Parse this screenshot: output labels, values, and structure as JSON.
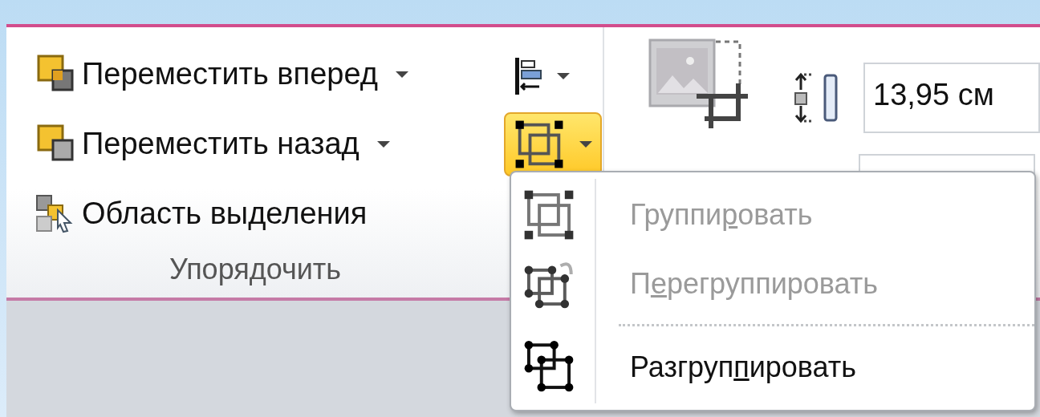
{
  "arrange_group": {
    "title": "Упорядочить",
    "commands": [
      {
        "label": "Переместить вперед",
        "has_dropdown": true
      },
      {
        "label": "Переместить назад",
        "has_dropdown": true
      },
      {
        "label": "Область выделения",
        "has_dropdown": false
      }
    ],
    "align_button": {
      "has_dropdown": true
    },
    "group_button": {
      "active": true,
      "has_dropdown": true
    }
  },
  "size_group": {
    "height_value": "13,95 см"
  },
  "group_menu": {
    "items": [
      {
        "start": "Группи",
        "access_key": "р",
        "end": "овать",
        "disabled": true,
        "separator_before": false
      },
      {
        "start": "П",
        "access_key": "е",
        "end": "регруппировать",
        "disabled": true,
        "separator_before": false
      },
      {
        "start": "Разгруп",
        "access_key": "п",
        "end": "ировать",
        "disabled": false,
        "separator_before": true
      }
    ]
  }
}
